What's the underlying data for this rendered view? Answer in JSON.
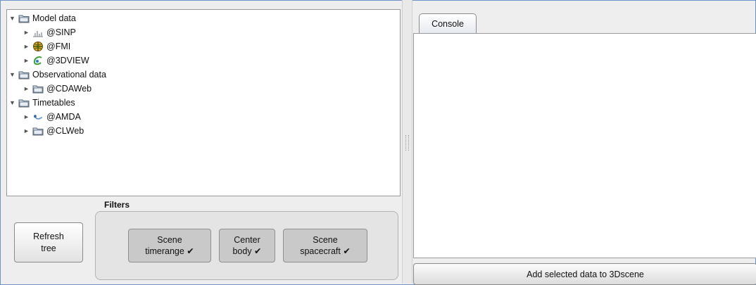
{
  "tree": {
    "nodes": [
      {
        "label": "Model data",
        "toggle": "▼",
        "icon": "folder-icon"
      },
      {
        "label": "@SINP",
        "toggle": "►",
        "icon": "chart-icon"
      },
      {
        "label": "@FMI",
        "toggle": "►",
        "icon": "globe-icon"
      },
      {
        "label": "@3DVIEW",
        "toggle": "►",
        "icon": "orbit-icon"
      },
      {
        "label": "Observational data",
        "toggle": "▼",
        "icon": "folder-icon"
      },
      {
        "label": "@CDAWeb",
        "toggle": "►",
        "icon": "folder-icon"
      },
      {
        "label": "Timetables",
        "toggle": "▼",
        "icon": "folder-icon"
      },
      {
        "label": "@AMDA",
        "toggle": "►",
        "icon": "amda-icon"
      },
      {
        "label": "@CLWeb",
        "toggle": "►",
        "icon": "folder-icon"
      }
    ]
  },
  "filters": {
    "label": "Filters",
    "buttons": [
      {
        "line1": "Scene",
        "line2": "timerange ✔"
      },
      {
        "line1": "Center",
        "line2": "body ✔"
      },
      {
        "line1": "Scene",
        "line2": "spacecraft ✔"
      }
    ]
  },
  "refresh": {
    "line1": "Refresh",
    "line2": "tree"
  },
  "console": {
    "tab_label": "Console"
  },
  "add_button": {
    "label": "Add selected data to 3Dscene"
  }
}
